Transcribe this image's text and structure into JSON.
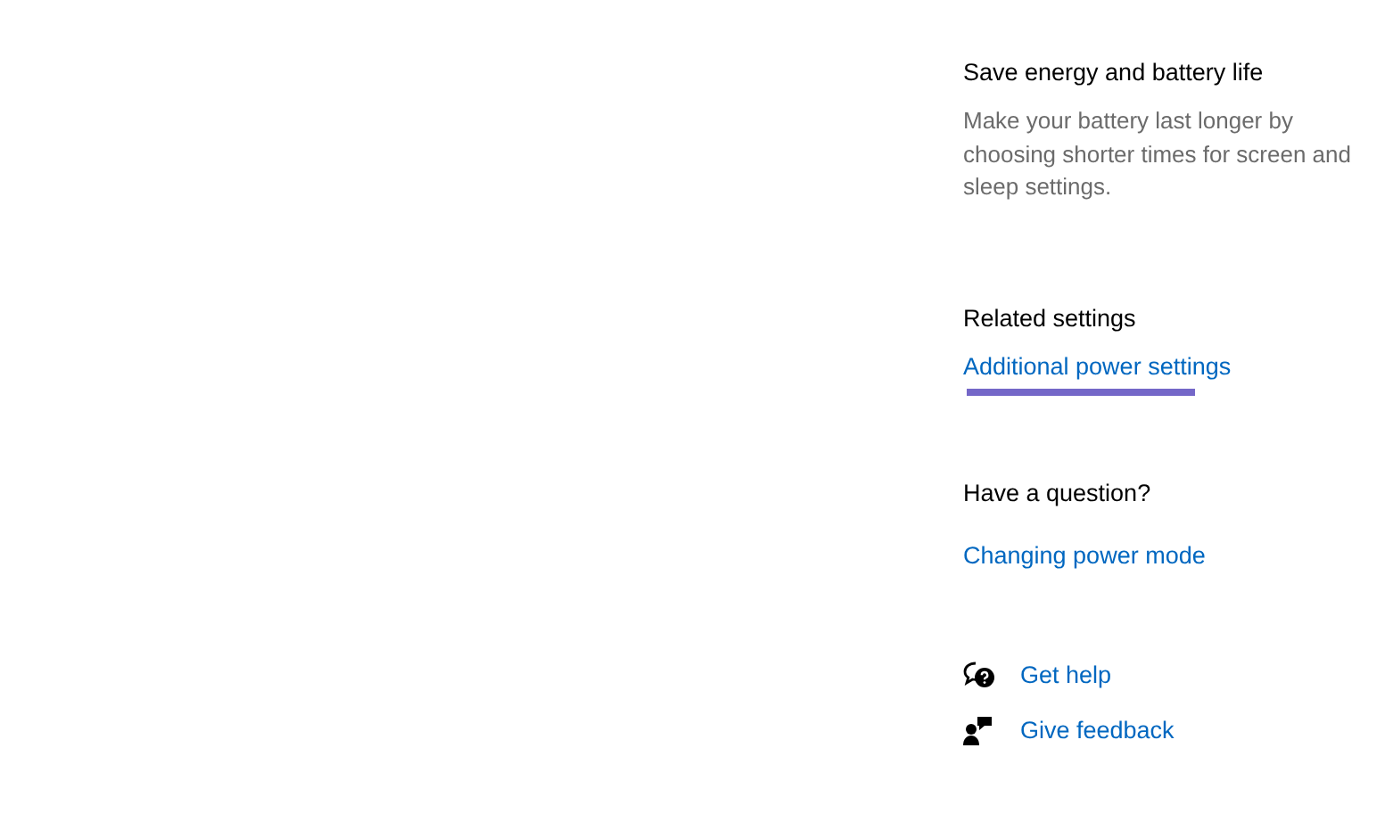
{
  "save_energy": {
    "title": "Save energy and battery life",
    "description": "Make your battery last longer by choosing shorter times for screen and sleep settings."
  },
  "related_settings": {
    "title": "Related settings",
    "links": [
      {
        "label": "Additional power settings",
        "highlighted": true
      }
    ]
  },
  "question": {
    "title": "Have a question?",
    "links": [
      {
        "label": "Changing power mode"
      }
    ]
  },
  "help_links": [
    {
      "kind": "help",
      "label": "Get help"
    },
    {
      "kind": "feedback",
      "label": "Give feedback"
    }
  ]
}
